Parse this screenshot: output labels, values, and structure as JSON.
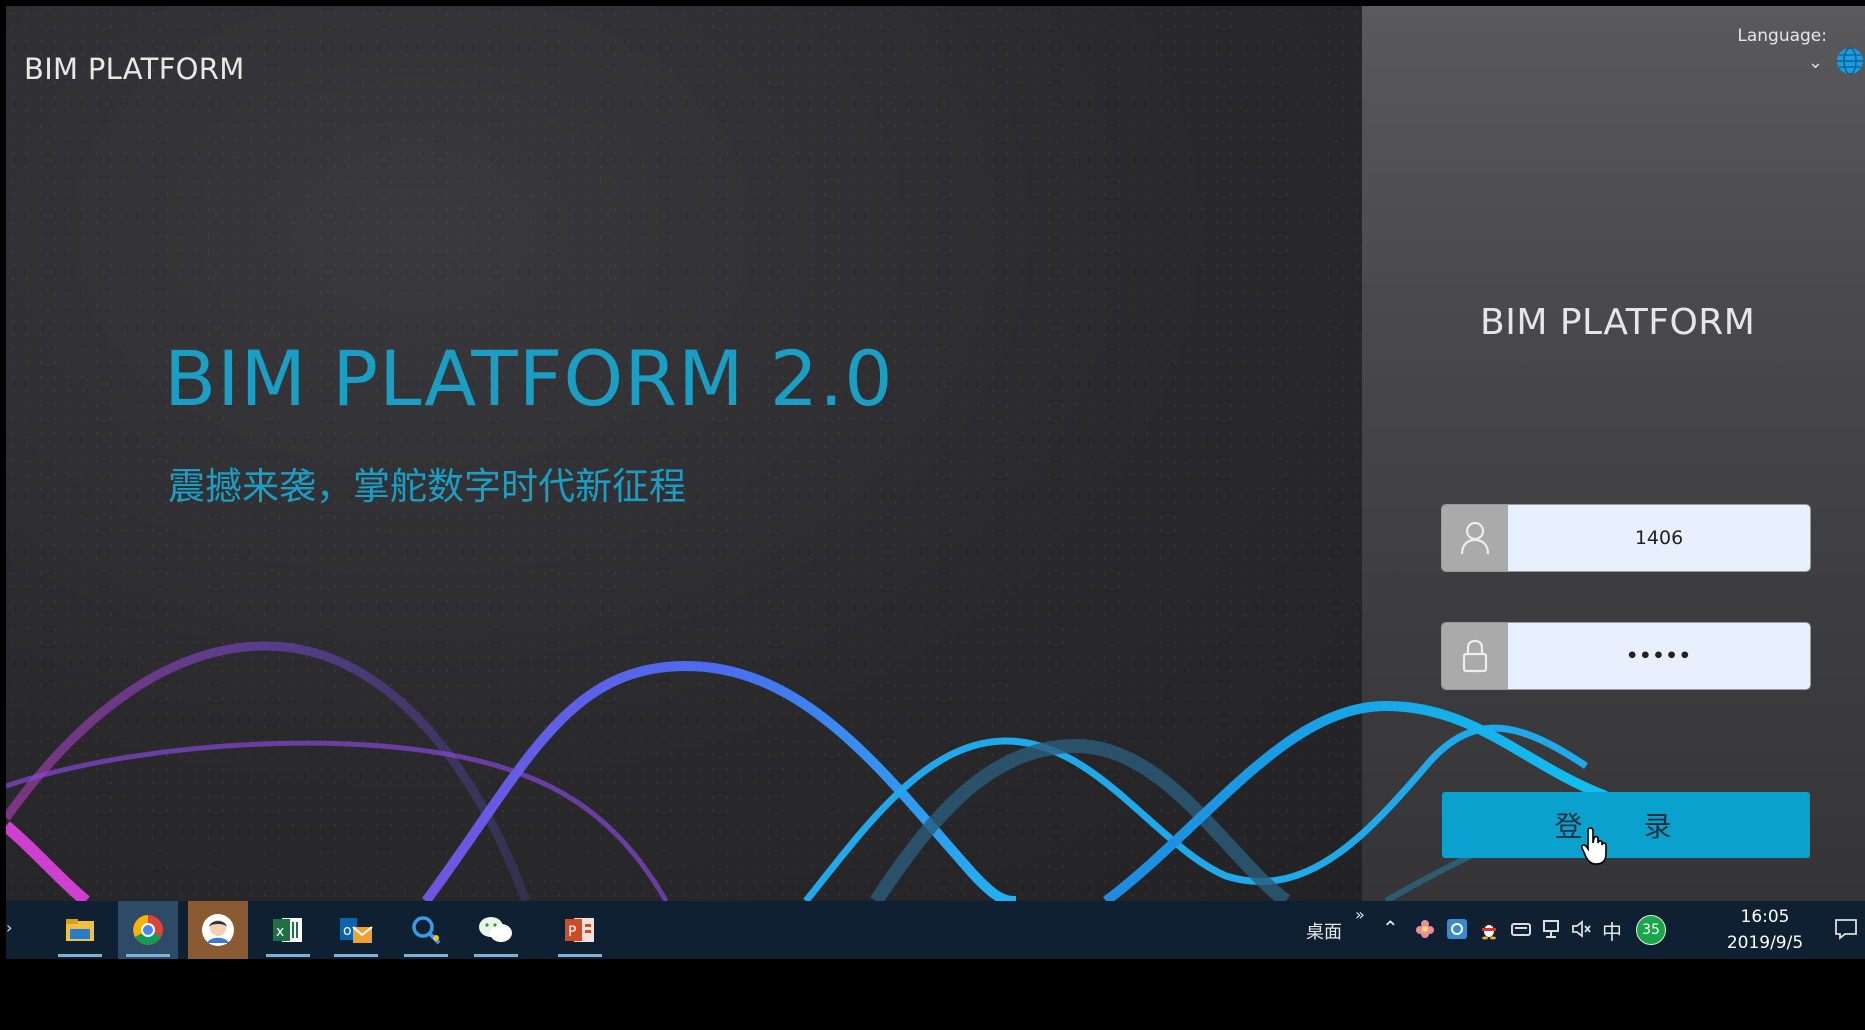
{
  "app": {
    "brand_small": "BIM PLATFORM",
    "hero_title": "BIM PLATFORM 2.0",
    "hero_subtitle": "震撼来袭，掌舵数字时代新征程",
    "language_label": "Language:",
    "brand_right": "BIM PLATFORM"
  },
  "login": {
    "username_value": "1406",
    "password_value": "•••••",
    "login_button": "登 录",
    "accent_color": "#0aa1cf"
  },
  "taskbar": {
    "apps": [
      "file-explorer-icon",
      "chrome-icon",
      "avatar-app-icon",
      "excel-icon",
      "outlook-icon",
      "search-app-icon",
      "wechat-icon",
      "powerpoint-icon"
    ],
    "desktop_label": "桌面",
    "overflow": "»",
    "ime_label": "中",
    "badge_count": "35",
    "time": "16:05",
    "date": "2019/9/5"
  }
}
